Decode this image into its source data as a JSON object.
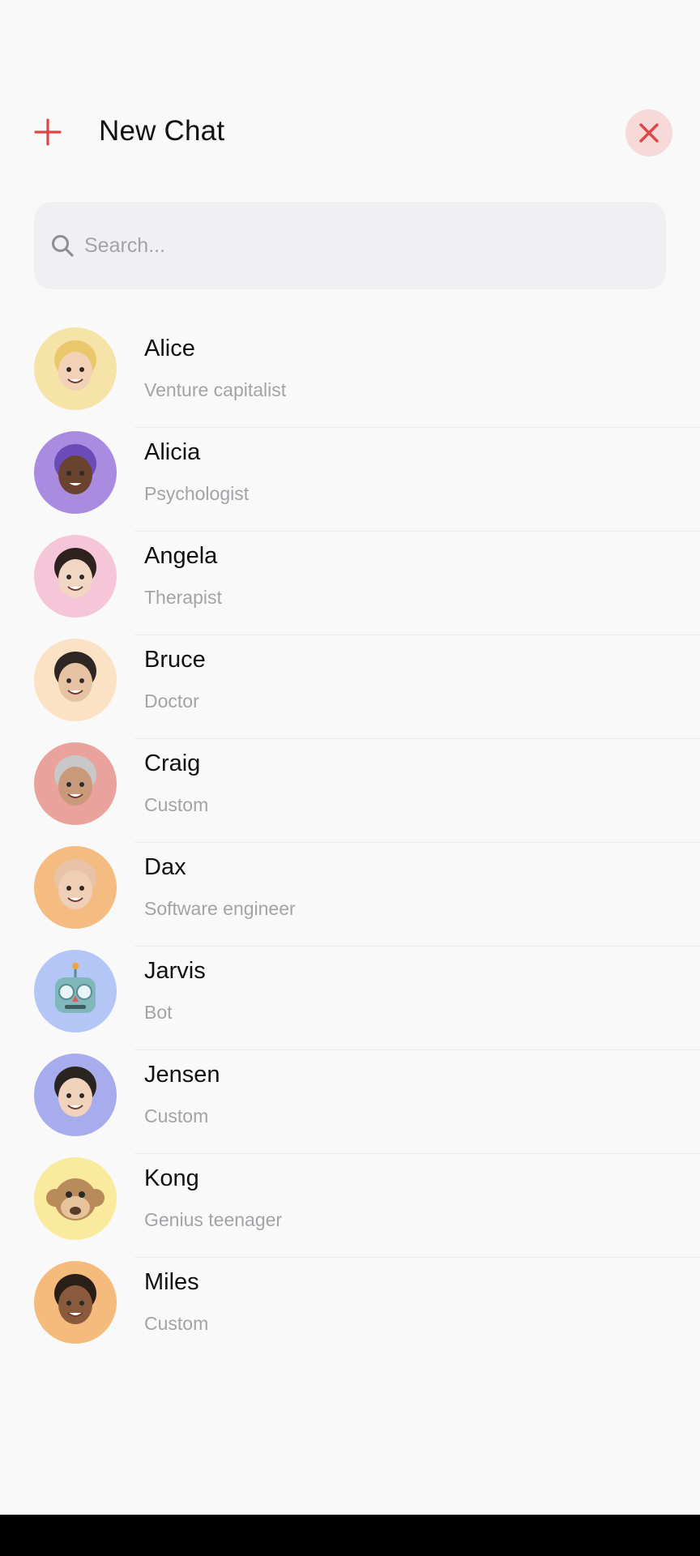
{
  "header": {
    "title": "New Chat",
    "add_icon": "plus-icon",
    "close_icon": "close-icon",
    "accent_color": "#e04545"
  },
  "search": {
    "placeholder": "Search...",
    "value": "",
    "icon": "search-icon"
  },
  "contacts": [
    {
      "name": "Alice",
      "role": "Venture capitalist",
      "avatar_bg": "#f6e3a8",
      "avatar_icon": "memoji-blonde-woman"
    },
    {
      "name": "Alicia",
      "role": "Psychologist",
      "avatar_bg": "#a98ce0",
      "avatar_icon": "memoji-purple-hair-woman"
    },
    {
      "name": "Angela",
      "role": "Therapist",
      "avatar_bg": "#f5c6d8",
      "avatar_icon": "memoji-dark-hair-woman"
    },
    {
      "name": "Bruce",
      "role": "Doctor",
      "avatar_bg": "#fbe2c4",
      "avatar_icon": "memoji-bearded-man-winking"
    },
    {
      "name": "Craig",
      "role": "Custom",
      "avatar_bg": "#e9a39c",
      "avatar_icon": "memoji-man-cap-glasses"
    },
    {
      "name": "Dax",
      "role": "Software engineer",
      "avatar_bg": "#f4bc80",
      "avatar_icon": "memoji-bald-bearded-man"
    },
    {
      "name": "Jarvis",
      "role": "Bot",
      "avatar_bg": "#b4c6f6",
      "avatar_icon": "robot"
    },
    {
      "name": "Jensen",
      "role": "Custom",
      "avatar_bg": "#a6acec",
      "avatar_icon": "memoji-man-glasses"
    },
    {
      "name": "Kong",
      "role": "Genius teenager",
      "avatar_bg": "#f9ea9e",
      "avatar_icon": "monkey"
    },
    {
      "name": "Miles",
      "role": "Custom",
      "avatar_bg": "#f5bb7c",
      "avatar_icon": "memoji-curly-hair-man"
    }
  ]
}
